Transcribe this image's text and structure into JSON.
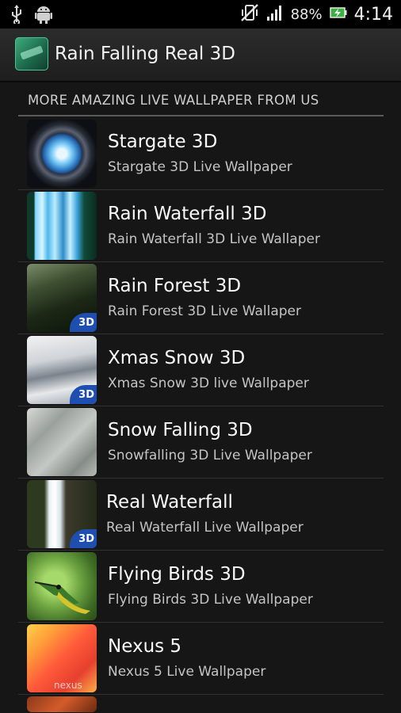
{
  "status_bar": {
    "icons": [
      "usb-icon",
      "android-debug-icon",
      "vibrate-off-icon",
      "signal-icon",
      "battery-charging-icon"
    ],
    "battery": "88%",
    "time": "4:14"
  },
  "action_bar": {
    "title": "Rain Falling Real 3D"
  },
  "section": {
    "header": "MORE AMAZING LIVE WALLPAPER FROM US"
  },
  "items": [
    {
      "title": "Stargate 3D",
      "subtitle": "Stargate 3D Live Wallpaper",
      "badge": ""
    },
    {
      "title": "Rain Waterfall 3D",
      "subtitle": "Rain Waterfall 3D Live Wallaper",
      "badge": ""
    },
    {
      "title": "Rain Forest 3D",
      "subtitle": "Rain Forest 3D Live Wallaper",
      "badge": "3D"
    },
    {
      "title": "Xmas Snow 3D",
      "subtitle": "Xmas Snow 3D live Wallpaper",
      "badge": "3D"
    },
    {
      "title": "Snow Falling 3D",
      "subtitle": "Snowfalling 3D Live Wallpaper",
      "badge": ""
    },
    {
      "title": "Real Waterfall",
      "subtitle": "Real Waterfall Live Wallpaper",
      "badge": "3D"
    },
    {
      "title": "Flying Birds 3D",
      "subtitle": "Flying Birds 3D Live Wallpaper",
      "badge": ""
    },
    {
      "title": "Nexus 5",
      "subtitle": "Nexus 5 Live Wallpaper",
      "badge": "",
      "thumb_text": "nexus"
    }
  ]
}
